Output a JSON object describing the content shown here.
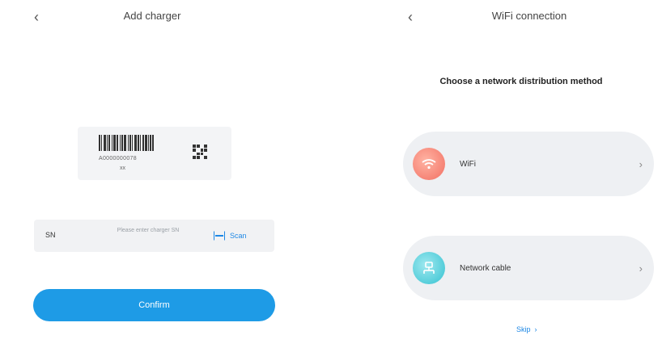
{
  "add_charger": {
    "title": "Add charger",
    "back_icon": "chevron-left-icon",
    "sample": {
      "barcode_number": "A0000000078",
      "caption": "xx",
      "qr_icon": "qr-code-icon"
    },
    "sn_field": {
      "label": "SN",
      "placeholder": "Please enter charger SN",
      "scan_label": "Scan",
      "scan_icon": "scan-icon"
    },
    "confirm_label": "Confirm",
    "colors": {
      "accent": "#1e9be6"
    }
  },
  "wifi_connection": {
    "title": "WiFi connection",
    "back_icon": "chevron-left-icon",
    "heading": "Choose a network distribution method",
    "methods": [
      {
        "label": "WiFi",
        "icon": "wifi-icon",
        "color": "#f26f62"
      },
      {
        "label": "Network cable",
        "icon": "network-cable-icon",
        "color": "#35c2d1"
      }
    ],
    "skip_label": "Skip",
    "skip_icon": "chevron-right-icon"
  }
}
